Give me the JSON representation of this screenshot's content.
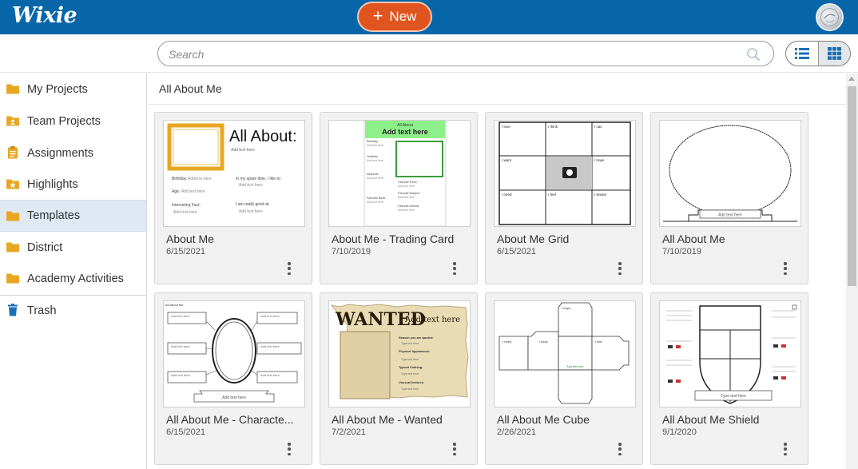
{
  "app": {
    "logo_text": "Wixie",
    "new_button_label": "New"
  },
  "search": {
    "placeholder": "Search"
  },
  "sidebar": {
    "items": [
      {
        "label": "My Projects",
        "icon": "folder-icon"
      },
      {
        "label": "Team Projects",
        "icon": "team-folder-icon"
      },
      {
        "label": "Assignments",
        "icon": "clipboard-icon"
      },
      {
        "label": "Highlights",
        "icon": "star-folder-icon"
      },
      {
        "label": "Templates",
        "icon": "folder-icon",
        "active": true
      },
      {
        "label": "District",
        "icon": "folder-icon"
      },
      {
        "label": "Academy Activities",
        "icon": "folder-icon"
      },
      {
        "label": "Trash",
        "icon": "trash-icon"
      }
    ]
  },
  "main": {
    "breadcrumb": "All About Me",
    "cards": [
      {
        "title": "About Me",
        "date": "6/15/2021",
        "thumb": {
          "heading": "All About:",
          "add": "Add text here",
          "lines": [
            "Birthday:",
            "Address here",
            "Age:",
            "Add text here",
            "In my spare time, I like to:",
            "Add text here",
            "Interesting Fact:",
            "Add text here",
            "I am really good at:",
            "Add text here"
          ]
        }
      },
      {
        "title": "About Me - Trading Card",
        "date": "7/10/2019",
        "thumb": {
          "banner": "All About",
          "add": "Add text here",
          "lines": [
            "Birthday",
            "Add text here",
            "Hobbies",
            "Add text here",
            "Interests",
            "Add text here",
            "Favorite Food",
            "Add text here",
            "Favorite Book",
            "Add text here",
            "Favorite Subject",
            "Add text here",
            "Favorite Animal",
            "Add text here"
          ]
        }
      },
      {
        "title": "About Me Grid",
        "date": "6/15/2021",
        "thumb": {
          "cells": [
            "I love",
            "I think",
            "I can",
            "I want",
            "",
            "I hope",
            "I need",
            "I feel",
            "I dream"
          ]
        }
      },
      {
        "title": "All About Me",
        "date": "7/10/2019",
        "thumb": {
          "add": "Add text here"
        }
      },
      {
        "title": "All About Me - Characte...",
        "date": "6/15/2021",
        "thumb": {
          "heading": "All About Me",
          "add": "Add text here"
        }
      },
      {
        "title": "All About Me - Wanted",
        "date": "7/2/2021",
        "thumb": {
          "wanted": "WANTED",
          "add": "Add text here",
          "lines": [
            "Reason you are wanted:",
            "Type text here",
            "Physical Appearance:",
            "Type text here",
            "Typical Clothing:",
            "Type text here",
            "Unusual features:",
            "Type text here"
          ]
        }
      },
      {
        "title": "All About Me Cube",
        "date": "2/26/2021",
        "thumb": {
          "faces": [
            "I need",
            "I think",
            "I feel",
            "I hope"
          ],
          "center": "Add text here"
        }
      },
      {
        "title": "All About Me Shield",
        "date": "9/1/2020",
        "thumb": {
          "add": "Type text here"
        }
      }
    ]
  },
  "colors": {
    "topbar": "#0766a8",
    "new_button": "#e0541f",
    "folder": "#e8a723",
    "trash": "#1c6fb5",
    "active_nav": "#dfe9f3"
  }
}
